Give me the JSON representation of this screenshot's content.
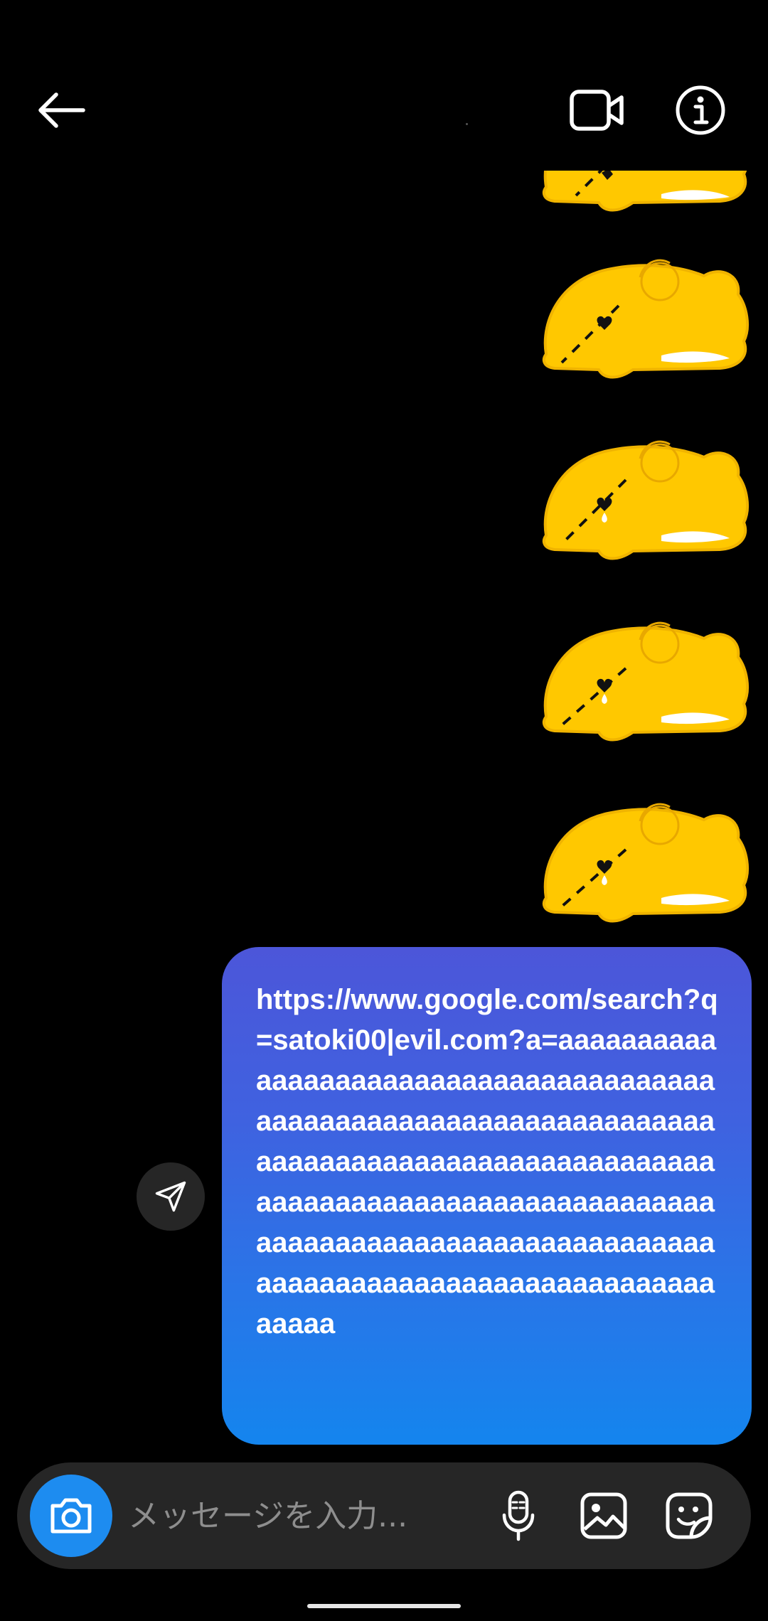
{
  "header": {
    "back_icon": "back-arrow-icon",
    "video_icon": "video-call-icon",
    "info_icon": "info-icon"
  },
  "thread": {
    "stickers": [
      {
        "name": "yellow-bear-sticker",
        "color": "#ffc800"
      },
      {
        "name": "yellow-bear-sticker",
        "color": "#ffc800"
      },
      {
        "name": "yellow-bear-sticker",
        "color": "#ffc800"
      },
      {
        "name": "yellow-bear-sticker",
        "color": "#ffc800"
      },
      {
        "name": "yellow-bear-sticker",
        "color": "#ffc800"
      }
    ],
    "message_text": "https://www.google.com/search?q=satoki00|evil.com?a=aaaaaaaaaaaaaaaaaaaaaaaaaaaaaaaaaaaaaaaaaaaaaaaaaaaaaaaaaaaaaaaaaaaaaaaaaaaaaaaaaaaaaaaaaaaaaaaaaaaaaaaaaaaaaaaaaaaaaaaaaaaaaaaaaaaaaaaaaaaaaaaaaaaaaaaaaaaaaaaaaaaaaaaaaaaaaaaaaaaaaaaaaaaaa",
    "share_icon": "paper-plane-icon"
  },
  "composer": {
    "placeholder": "メッセージを入力...",
    "camera_icon": "camera-icon",
    "mic_icon": "microphone-icon",
    "gallery_icon": "image-gallery-icon",
    "sticker_icon": "sticker-icon"
  },
  "colors": {
    "background": "#000000",
    "bubble_top": "#4c56d9",
    "bubble_bottom": "#1485ee",
    "camera_button": "#1d8cf0",
    "sticker_yellow": "#ffc800",
    "composer_bg": "#262626"
  }
}
